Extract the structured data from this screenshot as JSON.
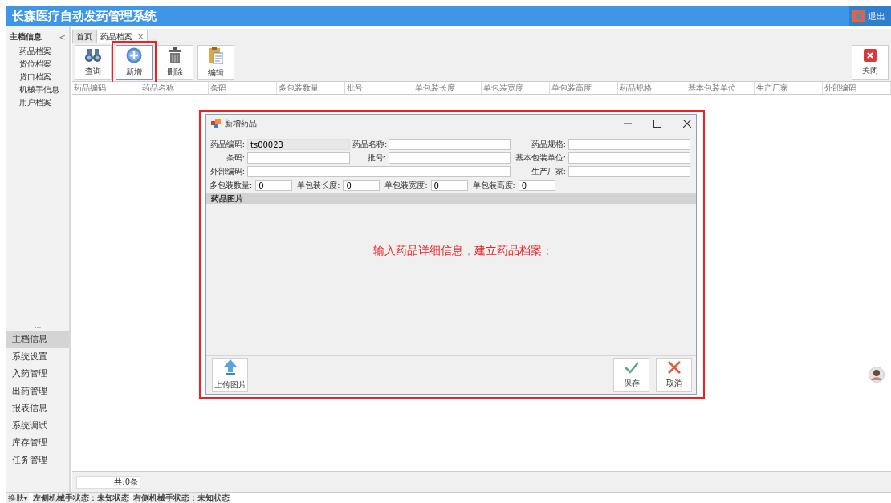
{
  "window": {
    "title": "长森医疗自动发药管理系统",
    "exit_button": "退出"
  },
  "sidebar": {
    "header": "主档信息",
    "collapse": "<",
    "items": [
      {
        "label": "药品档案"
      },
      {
        "label": "货位档案"
      },
      {
        "label": "货口档案"
      },
      {
        "label": "机械手信息"
      },
      {
        "label": "用户档案"
      }
    ],
    "more": "...",
    "nav": [
      {
        "label": "主档信息",
        "selected": true
      },
      {
        "label": "系统设置",
        "selected": false
      },
      {
        "label": "入药管理",
        "selected": false
      },
      {
        "label": "出药管理",
        "selected": false
      },
      {
        "label": "报表信息",
        "selected": false
      },
      {
        "label": "系统调试",
        "selected": false
      },
      {
        "label": "库存管理",
        "selected": false
      },
      {
        "label": "任务管理",
        "selected": false
      }
    ]
  },
  "tabs": [
    {
      "label": "首页",
      "selected": false
    },
    {
      "label": "药品档案",
      "selected": true,
      "close": "×"
    }
  ],
  "toolbar": [
    {
      "kind": "search",
      "label": "查询",
      "highlighted": false
    },
    {
      "kind": "add",
      "label": "新增",
      "highlighted": true
    },
    {
      "kind": "delete",
      "label": "删除",
      "highlighted": false
    },
    {
      "kind": "edit",
      "label": "编辑",
      "highlighted": false
    }
  ],
  "close_button": "关闭",
  "table": {
    "columns": [
      "药品编码",
      "药品名称",
      "条码",
      "多包装数量",
      "批号",
      "单包装长度",
      "单包装宽度",
      "单包装高度",
      "药品规格",
      "基本包装单位",
      "生产厂家",
      "外部编码"
    ]
  },
  "footer": {
    "count": "共:0条"
  },
  "status_bar": {
    "skin_menu": "换肤",
    "caret": "▾",
    "statuses": [
      "左侧机械手状态：未知状态",
      "右侧机械手状态：未知状态"
    ]
  },
  "dialog": {
    "title": "新增药品",
    "highlighted": true,
    "fields": [
      {
        "label": "药品编码:",
        "value": "ts00023",
        "readonly": true,
        "wide": false
      },
      {
        "label": "药品名称:",
        "readonly": false,
        "wide": false
      },
      {
        "label": "药品规格:",
        "readonly": false,
        "wide": false
      },
      {
        "label": "条码:",
        "readonly": false,
        "wide": false
      },
      {
        "label": "批号:",
        "readonly": false,
        "wide": false
      },
      {
        "label": "基本包装单位:",
        "readonly": false,
        "wide": false
      },
      {
        "label": "外部编码:",
        "readonly": false,
        "wide": true
      },
      {
        "label": "生产厂家:",
        "readonly": false,
        "wide": false
      }
    ],
    "size_fields": [
      {
        "label": "多包装数量:",
        "value": "0"
      },
      {
        "label": "单包装长度:",
        "value": "0"
      },
      {
        "label": "单包装宽度:",
        "value": "0"
      },
      {
        "label": "单包装高度:",
        "value": "0"
      }
    ],
    "picture_section": "药品图片",
    "annotation": "输入药品详细信息，建立药品档案；",
    "buttons": [
      {
        "kind": "upload",
        "label": "上传图片"
      },
      {
        "kind": "save",
        "label": "保存"
      },
      {
        "kind": "cancel",
        "label": "取消"
      }
    ]
  }
}
